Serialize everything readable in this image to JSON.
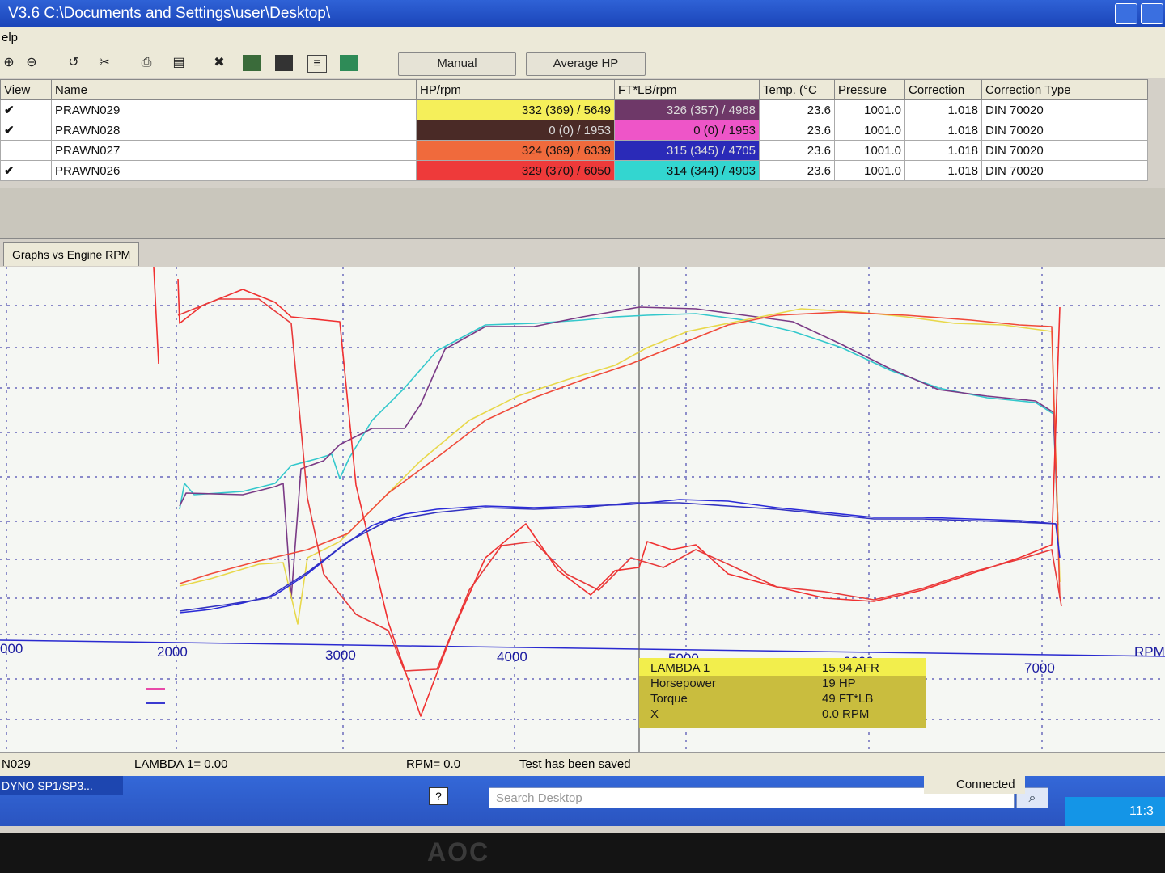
{
  "window": {
    "title": "V3.6  C:\\Documents and Settings\\user\\Desktop\\"
  },
  "menu": {
    "help": "elp"
  },
  "toolbar": {
    "manual_label": "Manual",
    "average_hp_label": "Average HP"
  },
  "table": {
    "headers": [
      "View",
      "Name",
      "HP/rpm",
      "FT*LB/rpm",
      "Temp. (°C",
      "Pressure",
      "Correction",
      "Correction Type"
    ],
    "rows": [
      {
        "name": "PRAWN029",
        "hp": "332 (369) / 5649",
        "ftlb": "326 (357) / 4968",
        "temp": "23.6",
        "pressure": "1001.0",
        "correction": "1.018",
        "type": "DIN 70020",
        "hp_color": "#f5ef5a",
        "ft_color": "#6e3868",
        "checked": true
      },
      {
        "name": "PRAWN028",
        "hp": "0 (0) / 1953",
        "ftlb": "0 (0) / 1953",
        "temp": "23.6",
        "pressure": "1001.0",
        "correction": "1.018",
        "type": "DIN 70020",
        "hp_color": "#4a2a26",
        "ft_color": "#ee55c8",
        "checked": true
      },
      {
        "name": "PRAWN027",
        "hp": "324 (369) / 6339",
        "ftlb": "315 (345) / 4705",
        "temp": "23.6",
        "pressure": "1001.0",
        "correction": "1.018",
        "type": "DIN 70020",
        "hp_color": "#f06a3c",
        "ft_color": "#2a2ab8",
        "checked": false
      },
      {
        "name": "PRAWN026",
        "hp": "329 (370) / 6050",
        "ftlb": "314 (344) / 4903",
        "temp": "23.6",
        "pressure": "1001.0",
        "correction": "1.018",
        "type": "DIN 70020",
        "hp_color": "#ee3a3a",
        "ft_color": "#33d6d0",
        "checked": true
      }
    ]
  },
  "graph": {
    "tab_label": "Graphs vs Engine RPM",
    "x_ticks": [
      "000",
      "2000",
      "3000",
      "4000",
      "5000",
      "6000",
      "7000"
    ],
    "x_unit": "RPM",
    "tooltip": {
      "rows": [
        {
          "label": "LAMBDA 1",
          "value": "15.94 AFR"
        },
        {
          "label": "Horsepower",
          "value": "19 HP"
        },
        {
          "label": "Torque",
          "value": "49 FT*LB"
        },
        {
          "label": "X",
          "value": "0.0 RPM"
        }
      ]
    }
  },
  "status": {
    "run": "N029",
    "lambda": "LAMBDA 1= 0.00",
    "rpm": "RPM= 0.0",
    "message": "Test has been saved"
  },
  "taskbar": {
    "task": "DYNO SP1/SP3...",
    "search_placeholder": "Search Desktop",
    "connected": "Connected",
    "clock": "11:3"
  },
  "monitor": {
    "brand": "AOC"
  }
}
